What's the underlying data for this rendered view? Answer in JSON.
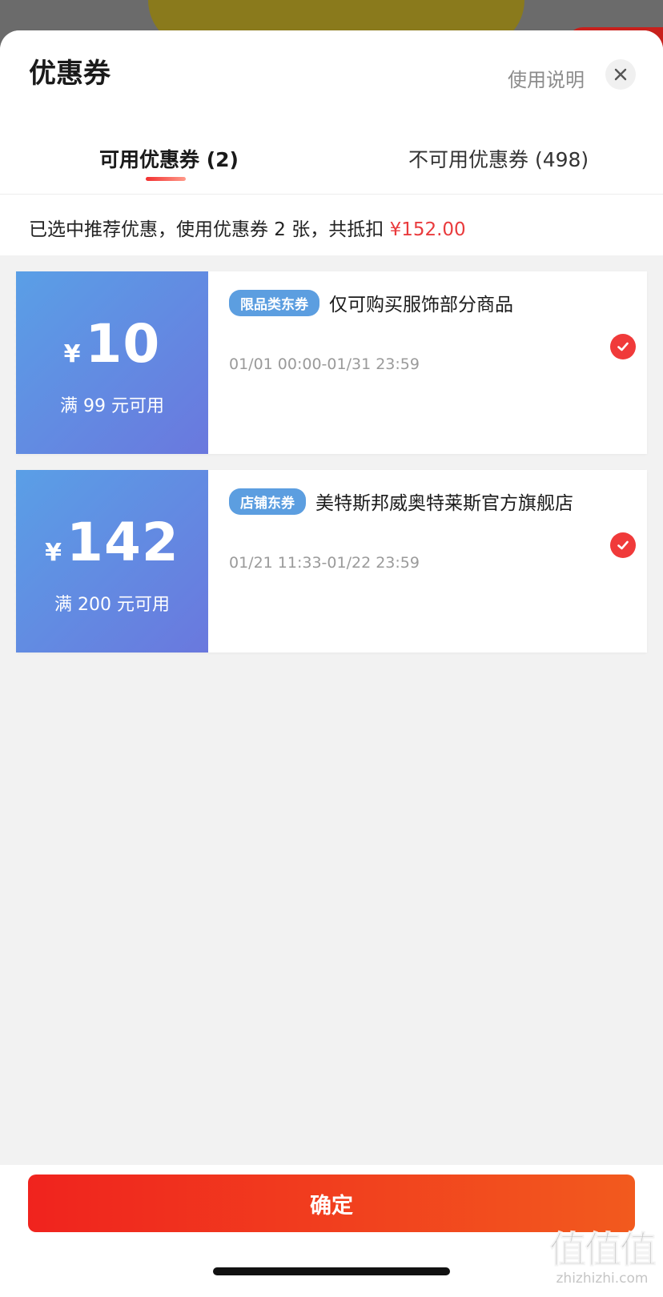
{
  "header": {
    "title": "优惠券",
    "help_label": "使用说明"
  },
  "tabs": [
    {
      "label": "可用优惠券 (2)",
      "active": true
    },
    {
      "label": "不可用优惠券 (498)",
      "active": false
    }
  ],
  "summary": {
    "text": "已选中推荐优惠，使用优惠券 2 张，共抵扣 ",
    "amount": "¥152.00"
  },
  "coupons": [
    {
      "currency": "¥",
      "value": "10",
      "threshold": "满 99 元可用",
      "tag": "限品类东券",
      "description": "仅可购买服饰部分商品",
      "validity": "01/01 00:00-01/31 23:59",
      "selected": true
    },
    {
      "currency": "¥",
      "value": "142",
      "threshold": "满 200 元可用",
      "tag": "店铺东券",
      "description": "美特斯邦威奥特莱斯官方旗舰店",
      "validity": "01/21 11:33-01/22 23:59",
      "selected": true
    }
  ],
  "footer": {
    "confirm_label": "确定"
  },
  "watermark": {
    "chars": "值值值",
    "url": "zhizhizhi.com"
  },
  "colors": {
    "accent_red": "#e93b3d",
    "coupon_gradient_start": "#5a9fe6",
    "coupon_gradient_end": "#6a78de",
    "tag_blue": "#5c9ee0"
  },
  "icons": {
    "close": "close-icon",
    "check": "check-circle-icon"
  }
}
